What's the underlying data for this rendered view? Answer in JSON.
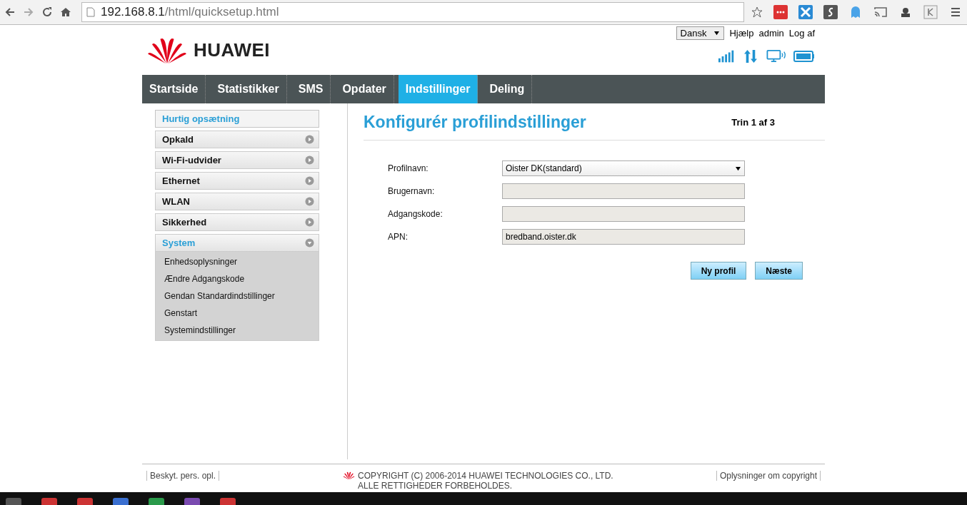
{
  "browser": {
    "url_host": "192.168.8.1",
    "url_path": "/html/quicksetup.html"
  },
  "header": {
    "brand": "HUAWEI",
    "language": "Dansk",
    "links": [
      "Hjælp",
      "admin",
      "Log af"
    ]
  },
  "nav": {
    "tabs": [
      {
        "label": "Startside",
        "selected": false
      },
      {
        "label": "Statistikker",
        "selected": false
      },
      {
        "label": "SMS",
        "selected": false
      },
      {
        "label": "Opdater",
        "selected": false
      },
      {
        "label": "Indstillinger",
        "selected": true
      },
      {
        "label": "Deling",
        "selected": false
      }
    ]
  },
  "sidebar": {
    "items": [
      {
        "label": "Hurtig opsætning",
        "kind": "link",
        "selected": true
      },
      {
        "label": "Opkald",
        "kind": "group",
        "selected": false,
        "expanded": false
      },
      {
        "label": "Wi-Fi-udvider",
        "kind": "group",
        "selected": false,
        "expanded": false
      },
      {
        "label": "Ethernet",
        "kind": "group",
        "selected": false,
        "expanded": false
      },
      {
        "label": "WLAN",
        "kind": "group",
        "selected": false,
        "expanded": false
      },
      {
        "label": "Sikkerhed",
        "kind": "group",
        "selected": false,
        "expanded": false
      },
      {
        "label": "System",
        "kind": "group",
        "selected": false,
        "expanded": true,
        "children": [
          {
            "label": "Enhedsoplysninger"
          },
          {
            "label": "Ændre Adgangskode"
          },
          {
            "label": "Gendan Standardindstillinger"
          },
          {
            "label": "Genstart"
          },
          {
            "label": "Systemindstillinger"
          }
        ]
      }
    ]
  },
  "content": {
    "title": "Konfigurér profilindstillinger",
    "step": "Trin 1 af 3",
    "fields": [
      {
        "label": "Profilnavn:",
        "kind": "select",
        "value": "Oister DK(standard)",
        "disabled": false
      },
      {
        "label": "Brugernavn:",
        "kind": "text",
        "disabled": true
      },
      {
        "label": "Adgangskode:",
        "kind": "text",
        "disabled": true
      },
      {
        "label": "APN:",
        "kind": "text",
        "value": "bredband.oister.dk",
        "disabled": true
      }
    ],
    "buttons": [
      "Ny profil",
      "Næste"
    ]
  },
  "footer": {
    "left": "Beskyt. pers. opl.",
    "copyright": [
      "COPYRIGHT (C) 2006-2014 HUAWEI TECHNOLOGIES CO., LTD.",
      "ALLE RETTIGHEDER FORBEHOLDES."
    ],
    "right": "Oplysninger om copyright"
  }
}
